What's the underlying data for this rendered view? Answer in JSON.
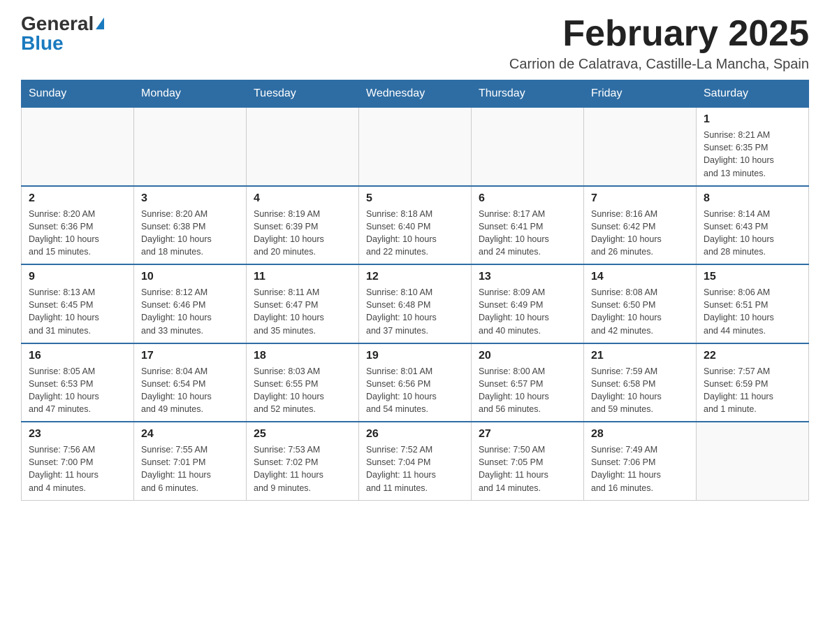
{
  "header": {
    "logo_general": "General",
    "logo_blue": "Blue",
    "month_title": "February 2025",
    "subtitle": "Carrion de Calatrava, Castille-La Mancha, Spain"
  },
  "weekdays": [
    "Sunday",
    "Monday",
    "Tuesday",
    "Wednesday",
    "Thursday",
    "Friday",
    "Saturday"
  ],
  "weeks": [
    [
      {
        "day": "",
        "info": ""
      },
      {
        "day": "",
        "info": ""
      },
      {
        "day": "",
        "info": ""
      },
      {
        "day": "",
        "info": ""
      },
      {
        "day": "",
        "info": ""
      },
      {
        "day": "",
        "info": ""
      },
      {
        "day": "1",
        "info": "Sunrise: 8:21 AM\nSunset: 6:35 PM\nDaylight: 10 hours\nand 13 minutes."
      }
    ],
    [
      {
        "day": "2",
        "info": "Sunrise: 8:20 AM\nSunset: 6:36 PM\nDaylight: 10 hours\nand 15 minutes."
      },
      {
        "day": "3",
        "info": "Sunrise: 8:20 AM\nSunset: 6:38 PM\nDaylight: 10 hours\nand 18 minutes."
      },
      {
        "day": "4",
        "info": "Sunrise: 8:19 AM\nSunset: 6:39 PM\nDaylight: 10 hours\nand 20 minutes."
      },
      {
        "day": "5",
        "info": "Sunrise: 8:18 AM\nSunset: 6:40 PM\nDaylight: 10 hours\nand 22 minutes."
      },
      {
        "day": "6",
        "info": "Sunrise: 8:17 AM\nSunset: 6:41 PM\nDaylight: 10 hours\nand 24 minutes."
      },
      {
        "day": "7",
        "info": "Sunrise: 8:16 AM\nSunset: 6:42 PM\nDaylight: 10 hours\nand 26 minutes."
      },
      {
        "day": "8",
        "info": "Sunrise: 8:14 AM\nSunset: 6:43 PM\nDaylight: 10 hours\nand 28 minutes."
      }
    ],
    [
      {
        "day": "9",
        "info": "Sunrise: 8:13 AM\nSunset: 6:45 PM\nDaylight: 10 hours\nand 31 minutes."
      },
      {
        "day": "10",
        "info": "Sunrise: 8:12 AM\nSunset: 6:46 PM\nDaylight: 10 hours\nand 33 minutes."
      },
      {
        "day": "11",
        "info": "Sunrise: 8:11 AM\nSunset: 6:47 PM\nDaylight: 10 hours\nand 35 minutes."
      },
      {
        "day": "12",
        "info": "Sunrise: 8:10 AM\nSunset: 6:48 PM\nDaylight: 10 hours\nand 37 minutes."
      },
      {
        "day": "13",
        "info": "Sunrise: 8:09 AM\nSunset: 6:49 PM\nDaylight: 10 hours\nand 40 minutes."
      },
      {
        "day": "14",
        "info": "Sunrise: 8:08 AM\nSunset: 6:50 PM\nDaylight: 10 hours\nand 42 minutes."
      },
      {
        "day": "15",
        "info": "Sunrise: 8:06 AM\nSunset: 6:51 PM\nDaylight: 10 hours\nand 44 minutes."
      }
    ],
    [
      {
        "day": "16",
        "info": "Sunrise: 8:05 AM\nSunset: 6:53 PM\nDaylight: 10 hours\nand 47 minutes."
      },
      {
        "day": "17",
        "info": "Sunrise: 8:04 AM\nSunset: 6:54 PM\nDaylight: 10 hours\nand 49 minutes."
      },
      {
        "day": "18",
        "info": "Sunrise: 8:03 AM\nSunset: 6:55 PM\nDaylight: 10 hours\nand 52 minutes."
      },
      {
        "day": "19",
        "info": "Sunrise: 8:01 AM\nSunset: 6:56 PM\nDaylight: 10 hours\nand 54 minutes."
      },
      {
        "day": "20",
        "info": "Sunrise: 8:00 AM\nSunset: 6:57 PM\nDaylight: 10 hours\nand 56 minutes."
      },
      {
        "day": "21",
        "info": "Sunrise: 7:59 AM\nSunset: 6:58 PM\nDaylight: 10 hours\nand 59 minutes."
      },
      {
        "day": "22",
        "info": "Sunrise: 7:57 AM\nSunset: 6:59 PM\nDaylight: 11 hours\nand 1 minute."
      }
    ],
    [
      {
        "day": "23",
        "info": "Sunrise: 7:56 AM\nSunset: 7:00 PM\nDaylight: 11 hours\nand 4 minutes."
      },
      {
        "day": "24",
        "info": "Sunrise: 7:55 AM\nSunset: 7:01 PM\nDaylight: 11 hours\nand 6 minutes."
      },
      {
        "day": "25",
        "info": "Sunrise: 7:53 AM\nSunset: 7:02 PM\nDaylight: 11 hours\nand 9 minutes."
      },
      {
        "day": "26",
        "info": "Sunrise: 7:52 AM\nSunset: 7:04 PM\nDaylight: 11 hours\nand 11 minutes."
      },
      {
        "day": "27",
        "info": "Sunrise: 7:50 AM\nSunset: 7:05 PM\nDaylight: 11 hours\nand 14 minutes."
      },
      {
        "day": "28",
        "info": "Sunrise: 7:49 AM\nSunset: 7:06 PM\nDaylight: 11 hours\nand 16 minutes."
      },
      {
        "day": "",
        "info": ""
      }
    ]
  ]
}
